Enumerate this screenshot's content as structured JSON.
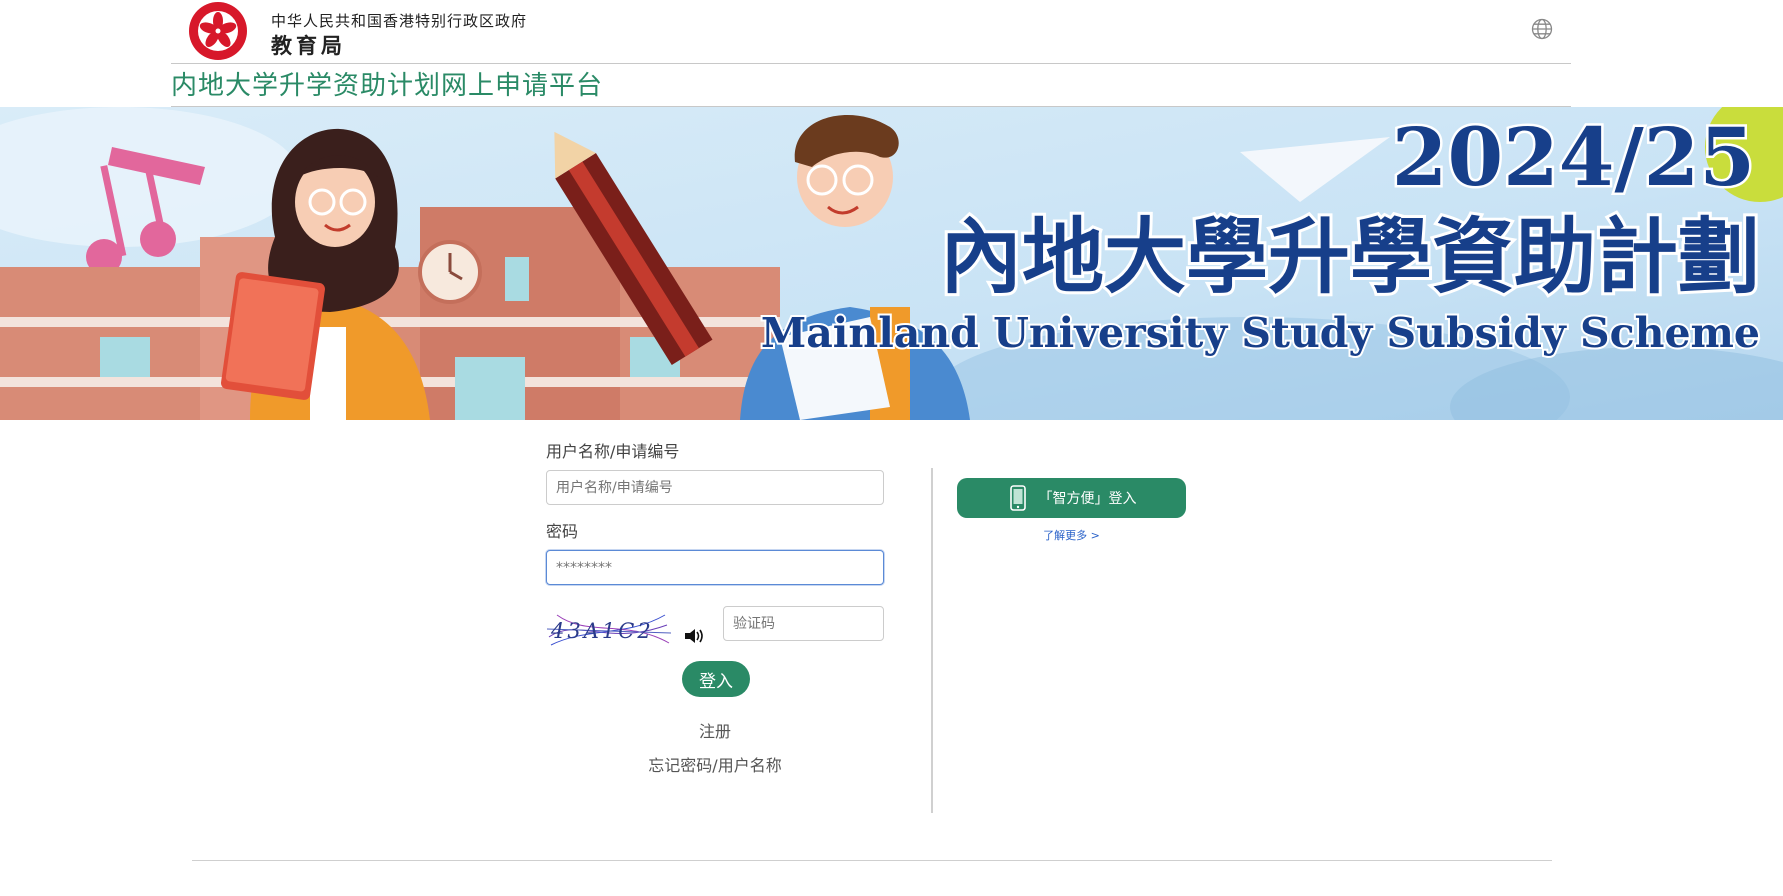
{
  "header": {
    "org_line1": "中华人民共和国香港特别行政区政府",
    "org_line2": "教育局",
    "emblem_icon": "hksar-emblem-icon",
    "language_icon": "globe-icon"
  },
  "platform_title": "内地大学升学资助计划网上申请平台",
  "banner": {
    "year": "2024/25",
    "title_zh": "內地大學升學資助計劃",
    "title_en": "Mainland University Study Subsidy Scheme"
  },
  "login": {
    "username_label": "用户名称/申请编号",
    "username_placeholder": "用户名称/申请编号",
    "password_label": "密码",
    "password_placeholder": "********",
    "captcha_text": "43A1C2",
    "captcha_placeholder": "验证码",
    "speaker_icon": "speaker-icon",
    "login_button": "登入",
    "register_link": "注册",
    "forgot_link": "忘记密码/用户名称"
  },
  "iamsmart": {
    "button_label": "「智方便」登入",
    "learn_more": "了解更多 >",
    "icon": "phone-icon"
  },
  "colors": {
    "brand_green": "#2a8a66",
    "banner_navy": "#173f8a"
  }
}
